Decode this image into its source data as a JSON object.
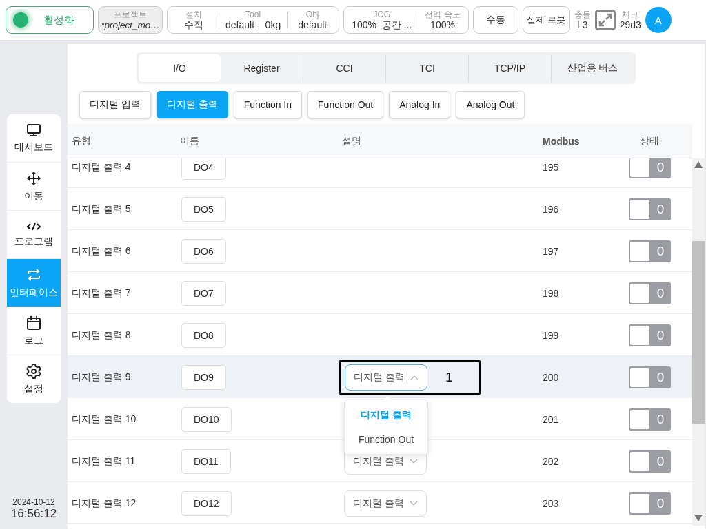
{
  "top_bar": {
    "status": {
      "label": "활성화",
      "active": true
    },
    "project": {
      "label": "프로젝트",
      "value": "*project_mo…"
    },
    "setup_group": [
      {
        "label": "설치",
        "value": "수직"
      },
      {
        "label": "Tool",
        "value": "default    0kg"
      },
      {
        "label": "Obj",
        "value": "default"
      }
    ],
    "jog_group": [
      {
        "label": "JOG",
        "value": "100%  공간 ..."
      },
      {
        "label": "전역 속도",
        "value": "100%"
      }
    ],
    "mode_button": "수동",
    "robot_button": "실제 로봇",
    "collision": {
      "label": "충돌",
      "value": "L3"
    },
    "check": {
      "label": "체크",
      "value": "29d3"
    },
    "avatar": "A"
  },
  "sidebar": {
    "items": [
      {
        "label": "대시보드",
        "selected": false
      },
      {
        "label": "이동",
        "selected": false
      },
      {
        "label": "프로그램",
        "selected": false
      },
      {
        "label": "인터페이스",
        "selected": true
      },
      {
        "label": "로그",
        "selected": false
      },
      {
        "label": "설정",
        "selected": false
      }
    ]
  },
  "clock": {
    "date": "2024-10-12",
    "time": "16:56:12"
  },
  "tabs": [
    {
      "label": "I/O",
      "selected": true
    },
    {
      "label": "Register",
      "selected": false
    },
    {
      "label": "CCI",
      "selected": false
    },
    {
      "label": "TCI",
      "selected": false
    },
    {
      "label": "TCP/IP",
      "selected": false
    },
    {
      "label": "산업용 버스",
      "selected": false
    }
  ],
  "sub_tabs": [
    {
      "label": "디지털 입력",
      "selected": false
    },
    {
      "label": "디지털 출력",
      "selected": true
    },
    {
      "label": "Function In",
      "selected": false
    },
    {
      "label": "Function Out",
      "selected": false
    },
    {
      "label": "Analog In",
      "selected": false
    },
    {
      "label": "Analog Out",
      "selected": false
    }
  ],
  "table": {
    "columns": [
      "유형",
      "이름",
      "설명",
      "Modbus",
      "상태"
    ],
    "rows": [
      {
        "type": "디지털 출력 4",
        "name": "DO4",
        "modbus": "195",
        "state": "0",
        "on": false,
        "selected": false
      },
      {
        "type": "디지털 출력 5",
        "name": "DO5",
        "modbus": "196",
        "state": "0",
        "on": false,
        "selected": false
      },
      {
        "type": "디지털 출력 6",
        "name": "DO6",
        "modbus": "197",
        "state": "0",
        "on": false,
        "selected": false
      },
      {
        "type": "디지털 출력 7",
        "name": "DO7",
        "modbus": "198",
        "state": "0",
        "on": false,
        "selected": false
      },
      {
        "type": "디지털 출력 8",
        "name": "DO8",
        "modbus": "199",
        "state": "0",
        "on": false,
        "selected": false
      },
      {
        "type": "디지털 출력 9",
        "name": "DO9",
        "description": {
          "value": "디지털 출력",
          "expanded": true,
          "annotation": "1",
          "options": [
            {
              "label": "디지털 출력",
              "selected": true
            },
            {
              "label": "Function Out",
              "selected": false
            }
          ]
        },
        "modbus": "200",
        "state": "0",
        "on": false,
        "selected": true
      },
      {
        "type": "디지털 출력 10",
        "name": "DO10",
        "modbus": "201",
        "state": "0",
        "on": false,
        "selected": false
      },
      {
        "type": "디지털 출력 11",
        "name": "DO11",
        "description": {
          "value": "디지털 출력",
          "expanded": false
        },
        "modbus": "202",
        "state": "0",
        "on": false,
        "selected": false
      },
      {
        "type": "디지털 출력 12",
        "name": "DO12",
        "description": {
          "value": "디지털 출력",
          "expanded": false
        },
        "modbus": "203",
        "state": "0",
        "on": false,
        "selected": false
      }
    ]
  }
}
